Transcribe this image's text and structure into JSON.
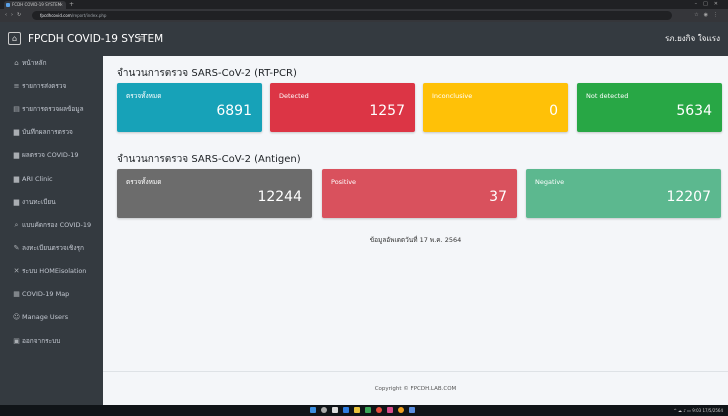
{
  "browser": {
    "tab_title": "FCDH COVID-19 SYSTEM",
    "url_host": "fpcdhcovid.com",
    "url_path": "/report/index.php"
  },
  "header": {
    "title": "FPCDH COVID-19 SYSTEM",
    "menu_toggle": "≡",
    "user": "รภ.ยงกิจ ใจเเรง"
  },
  "sidebar": {
    "items": [
      {
        "icon": "home-icon",
        "glyph": "⌂",
        "label": "หน้าหลัก"
      },
      {
        "icon": "list-icon",
        "glyph": "≡",
        "label": "รายการส่งตรวจ"
      },
      {
        "icon": "report-icon",
        "glyph": "▤",
        "label": "รายการตรวจผลข้อมูล"
      },
      {
        "icon": "file-icon",
        "glyph": "▆",
        "label": "บันทึกผลการตรวจ"
      },
      {
        "icon": "file-icon",
        "glyph": "▆",
        "label": "ผลตรวจ COVID-19"
      },
      {
        "icon": "file-icon",
        "glyph": "▆",
        "label": "ARI Clinic"
      },
      {
        "icon": "file-icon",
        "glyph": "▆",
        "label": "งานทะเบียน"
      },
      {
        "icon": "search-icon",
        "glyph": "⌕",
        "label": "แบบคัดกรอง COVID-19"
      },
      {
        "icon": "edit-icon",
        "glyph": "✎",
        "label": "ลงทะเบียนตรวจเชิงรุก"
      },
      {
        "icon": "users-icon",
        "glyph": "✕",
        "label": "ระบบ HOMEisolation"
      },
      {
        "icon": "map-icon",
        "glyph": "▦",
        "label": "COVID-19 Map"
      },
      {
        "icon": "user-gear-icon",
        "glyph": "☺",
        "label": "Manage Users"
      },
      {
        "icon": "logout-icon",
        "glyph": "▣",
        "label": "ออกจากระบบ"
      }
    ]
  },
  "rtpcr": {
    "title": "จำนวนการตรวจ SARS-CoV-2 (RT-PCR)",
    "cards": [
      {
        "label": "ตรวจทั้งหมด",
        "value": "6891",
        "color": "#17a2b8"
      },
      {
        "label": "Detected",
        "value": "1257",
        "color": "#dc3545"
      },
      {
        "label": "Inconclusive",
        "value": "0",
        "color": "#ffc107"
      },
      {
        "label": "Not detected",
        "value": "5634",
        "color": "#28a745"
      }
    ]
  },
  "antigen": {
    "title": "จำนวนการตรวจ SARS-CoV-2 (Antigen)",
    "cards": [
      {
        "label": "ตรวจทั้งหมด",
        "value": "12244",
        "color": "#6c6c6c"
      },
      {
        "label": "Positive",
        "value": "37",
        "color": "#d9515d"
      },
      {
        "label": "Negative",
        "value": "12207",
        "color": "#5cb88f"
      }
    ]
  },
  "updated": "ข้อมูลอัพเดตวันที่ 17 พ.ค. 2564",
  "footer": {
    "copyright": "Copyright © FPCDH.LAB.COM"
  },
  "taskbar": {
    "time": "9:03",
    "date": "17/5/2564"
  }
}
